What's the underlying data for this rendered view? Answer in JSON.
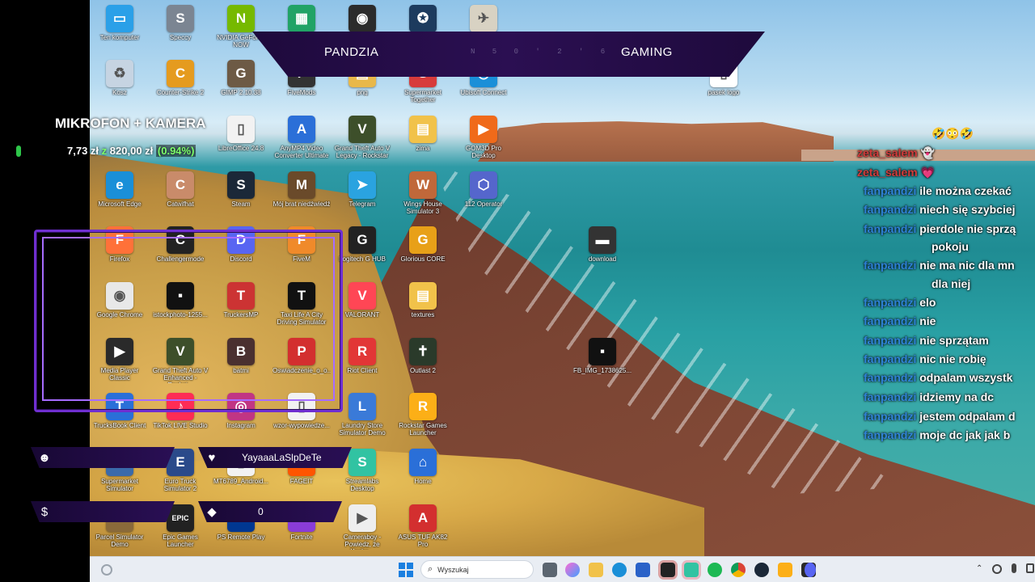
{
  "overlay": {
    "banner_left": "PANDZIA",
    "banner_right": "GAMING",
    "banner_coord": "N 5 0 ' 2 ' 6 5",
    "mic_title": "MIKROFON + KAMERA",
    "price_main": "7,73 zł",
    "price_z": "z",
    "price_goal": "820,00 zł",
    "price_pct": "(0.94%)",
    "follower_name": "YayaaaLaSlpDeTe",
    "gems": "0"
  },
  "desktop_icons": [
    {
      "label": "Ten komputer",
      "color": "#2aa0e8",
      "g": "▭"
    },
    {
      "label": "Speccy",
      "color": "#7b8592",
      "g": "S"
    },
    {
      "label": "NVIDIA GeForce NOW",
      "color": "#76b900",
      "g": "N"
    },
    {
      "label": "",
      "color": "#21a366",
      "g": "▦"
    },
    {
      "label": "",
      "color": "#2b2b2b",
      "g": "◉"
    },
    {
      "label": "",
      "color": "#1d3b5e",
      "g": "✪"
    },
    {
      "label": "",
      "color": "#d8d2c3",
      "g": "✈"
    },
    {
      "label": "Kosz",
      "color": "#c6d4e2",
      "g": "♻"
    },
    {
      "label": "Counter-Strike 2",
      "color": "#e59b1f",
      "g": "C"
    },
    {
      "label": "GIMP 2.10.38",
      "color": "#6d5a45",
      "g": "G"
    },
    {
      "label": "FiveMods",
      "color": "#333",
      "g": "F"
    },
    {
      "label": "png",
      "color": "#e8b84a",
      "g": "▤"
    },
    {
      "label": "Supermarket Together",
      "color": "#d73b3b",
      "g": "S"
    },
    {
      "label": "Ubisoft Connect",
      "color": "#1a8fd8",
      "g": "◎"
    },
    {
      "label": "LibreOffice 24.8",
      "color": "#f2f2f2",
      "g": "▯"
    },
    {
      "label": "AnyMP4 Video Converter Ultimate",
      "color": "#2b6fd8",
      "g": "A"
    },
    {
      "label": "Grand Theft Auto V Legacy - Rockstar",
      "color": "#3d4f2a",
      "g": "V"
    },
    {
      "label": "zima",
      "color": "#f1c24a",
      "g": "▤"
    },
    {
      "label": "GOM3D Pro Desktop",
      "color": "#f06a1a",
      "g": "▶"
    },
    {
      "label": "Microsoft Edge",
      "color": "#1a8fd8",
      "g": "e"
    },
    {
      "label": "Catwifhat",
      "color": "#c98b6a",
      "g": "C"
    },
    {
      "label": "Steam",
      "color": "#1b2838",
      "g": "S"
    },
    {
      "label": "Mój brat niedźwiedź",
      "color": "#6a4a2a",
      "g": "M"
    },
    {
      "label": "Telegram",
      "color": "#2aa3e0",
      "g": "➤"
    },
    {
      "label": "Wings House Simulator 3",
      "color": "#c0683a",
      "g": "W"
    },
    {
      "label": "112 Operator",
      "color": "#5566cc",
      "g": "⬡"
    },
    {
      "label": "Firefox",
      "color": "#ff7139",
      "g": "F"
    },
    {
      "label": "Challengermode",
      "color": "#222",
      "g": "C"
    },
    {
      "label": "Discord",
      "color": "#5865f2",
      "g": "D"
    },
    {
      "label": "FiveM",
      "color": "#f08a2a",
      "g": "F"
    },
    {
      "label": "Logitech G HUB",
      "color": "#222",
      "g": "G"
    },
    {
      "label": "Glorious CORE",
      "color": "#e8a018",
      "g": "G"
    },
    {
      "label": "download",
      "color": "#333",
      "g": "▬"
    },
    {
      "label": "Google Chrome",
      "color": "#e8e8e8",
      "g": "◉"
    },
    {
      "label": "istockphoto-1255...",
      "color": "#111",
      "g": "▪"
    },
    {
      "label": "TruckersMP",
      "color": "#c33",
      "g": "T"
    },
    {
      "label": "Taxi Life A City Driving Simulator",
      "color": "#111",
      "g": "T"
    },
    {
      "label": "VALORANT",
      "color": "#ff4655",
      "g": "V"
    },
    {
      "label": "textures",
      "color": "#f1c24a",
      "g": "▤"
    },
    {
      "label": "Media Player Classic",
      "color": "#2a2a2a",
      "g": "▶"
    },
    {
      "label": "Grand Theft Auto V Enhanced - Rockst...",
      "color": "#3d4f2a",
      "g": "V"
    },
    {
      "label": "batmi",
      "color": "#4a3030",
      "g": "B"
    },
    {
      "label": "Oswiadczenie_o_o...",
      "color": "#d32f2f",
      "g": "P"
    },
    {
      "label": "Riot Client",
      "color": "#e23636",
      "g": "R"
    },
    {
      "label": "Outlast 2",
      "color": "#2a3a2a",
      "g": "✝"
    },
    {
      "label": "FB_IMG_1738625...",
      "color": "#111",
      "g": "▪"
    },
    {
      "label": "TrucksBook Client",
      "color": "#2a6fd8",
      "g": "T"
    },
    {
      "label": "TikTok LIVE Studio",
      "color": "#fe2c55",
      "g": "♪"
    },
    {
      "label": "Instagram",
      "color": "#c13584",
      "g": "◎"
    },
    {
      "label": "wzor-wypowiedze...",
      "color": "#f2f2f2",
      "g": "▯"
    },
    {
      "label": "Laundry Store Simulator Demo",
      "color": "#3a7ad8",
      "g": "L"
    },
    {
      "label": "Rockstar Games Launcher",
      "color": "#fcaf17",
      "g": "R"
    },
    {
      "label": "Supermarket Simulator",
      "color": "#3a6aaa",
      "g": "S"
    },
    {
      "label": "Euro Truck Simulator 2",
      "color": "#2a4a8a",
      "g": "E"
    },
    {
      "label": "MT6789_Android...",
      "color": "#f2f2f2",
      "g": "▯"
    },
    {
      "label": "FAGEIT",
      "color": "#ff5500",
      "g": "F"
    },
    {
      "label": "Streamlabs Desktop",
      "color": "#31c3a2",
      "g": "S"
    },
    {
      "label": "Home",
      "color": "#2a6fd8",
      "g": "⌂"
    },
    {
      "label": "Parcel Simulator Demo",
      "color": "#8a6a3a",
      "g": "P"
    },
    {
      "label": "Epic Games Launcher",
      "color": "#222",
      "g": "EPIC"
    },
    {
      "label": "PS Remote Play",
      "color": "#003791",
      "g": "P"
    },
    {
      "label": "Fortnite",
      "color": "#8a3cd8",
      "g": "F"
    },
    {
      "label": "Cameraboy - Powiedz, że Kocha...",
      "color": "#eee",
      "g": "▶"
    },
    {
      "label": "ASUS TUF AK82 Pro",
      "color": "#d32f2f",
      "g": "A"
    },
    {
      "label": "pasek logo",
      "color": "#ffffff",
      "g": "▯"
    }
  ],
  "chat": [
    {
      "user": "zeta_salem",
      "msg": "",
      "badge": "👻",
      "red": true
    },
    {
      "user": "zeta_salem",
      "msg": "💗",
      "red": true
    },
    {
      "user": "fanpandzi",
      "msg": "ile można czekać"
    },
    {
      "user": "fanpandzi",
      "msg": "niech się szybciej"
    },
    {
      "user": "fanpandzi",
      "msg": "pierdole nie sprzą"
    },
    {
      "user": "",
      "msg": "pokoju"
    },
    {
      "user": "fanpandzi",
      "msg": "nie ma nic dla mn"
    },
    {
      "user": "",
      "msg": "dla niej"
    },
    {
      "user": "fanpandzi",
      "msg": "elo"
    },
    {
      "user": "fanpandzi",
      "msg": "nie"
    },
    {
      "user": "fanpandzi",
      "msg": "nie sprzątam"
    },
    {
      "user": "fanpandzi",
      "msg": "nic nie robię"
    },
    {
      "user": "fanpandzi",
      "msg": "odpalam wszystk"
    },
    {
      "user": "fanpandzi",
      "msg": "idziemy na dc"
    },
    {
      "user": "fanpandzi",
      "msg": "jestem odpalam d"
    },
    {
      "user": "fanpandzi",
      "msg": "moje dc jak jak b"
    }
  ],
  "chat_emojis": "🤣😳🤣",
  "taskbar": {
    "search_placeholder": "Wyszukaj"
  },
  "colors": {
    "overlay_purple": "#6f2fd0",
    "chat_red": "#d23b3b",
    "chat_blue": "#2f7de0",
    "price_green": "#7dff6a"
  }
}
